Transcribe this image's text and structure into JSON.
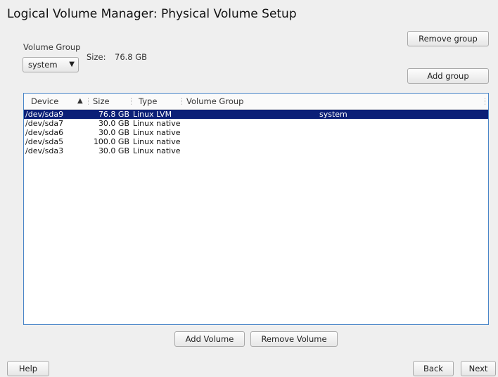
{
  "title": "Logical Volume Manager: Physical Volume Setup",
  "volume_group": {
    "label": "Volume Group",
    "selected": "system",
    "size_label": "Size:",
    "size_value": "76.8 GB"
  },
  "buttons": {
    "remove_group": "Remove group",
    "add_group": "Add group",
    "add_volume": "Add Volume",
    "remove_volume": "Remove Volume",
    "help": "Help",
    "back": "Back",
    "next": "Next"
  },
  "table": {
    "columns": [
      "Device",
      "Size",
      "Type",
      "Volume Group"
    ],
    "rows": [
      {
        "device": "/dev/sda9",
        "size": "76.8 GB",
        "type": "Linux LVM",
        "vg": "system"
      },
      {
        "device": "/dev/sda7",
        "size": "30.0 GB",
        "type": "Linux native",
        "vg": ""
      },
      {
        "device": "/dev/sda6",
        "size": "30.0 GB",
        "type": "Linux native",
        "vg": ""
      },
      {
        "device": "/dev/sda5",
        "size": "100.0 GB",
        "type": "Linux native",
        "vg": ""
      },
      {
        "device": "/dev/sda3",
        "size": "30.0 GB",
        "type": "Linux native",
        "vg": ""
      }
    ]
  },
  "colors": {
    "selection": "#0b1f77",
    "table_border": "#4a86c8"
  }
}
